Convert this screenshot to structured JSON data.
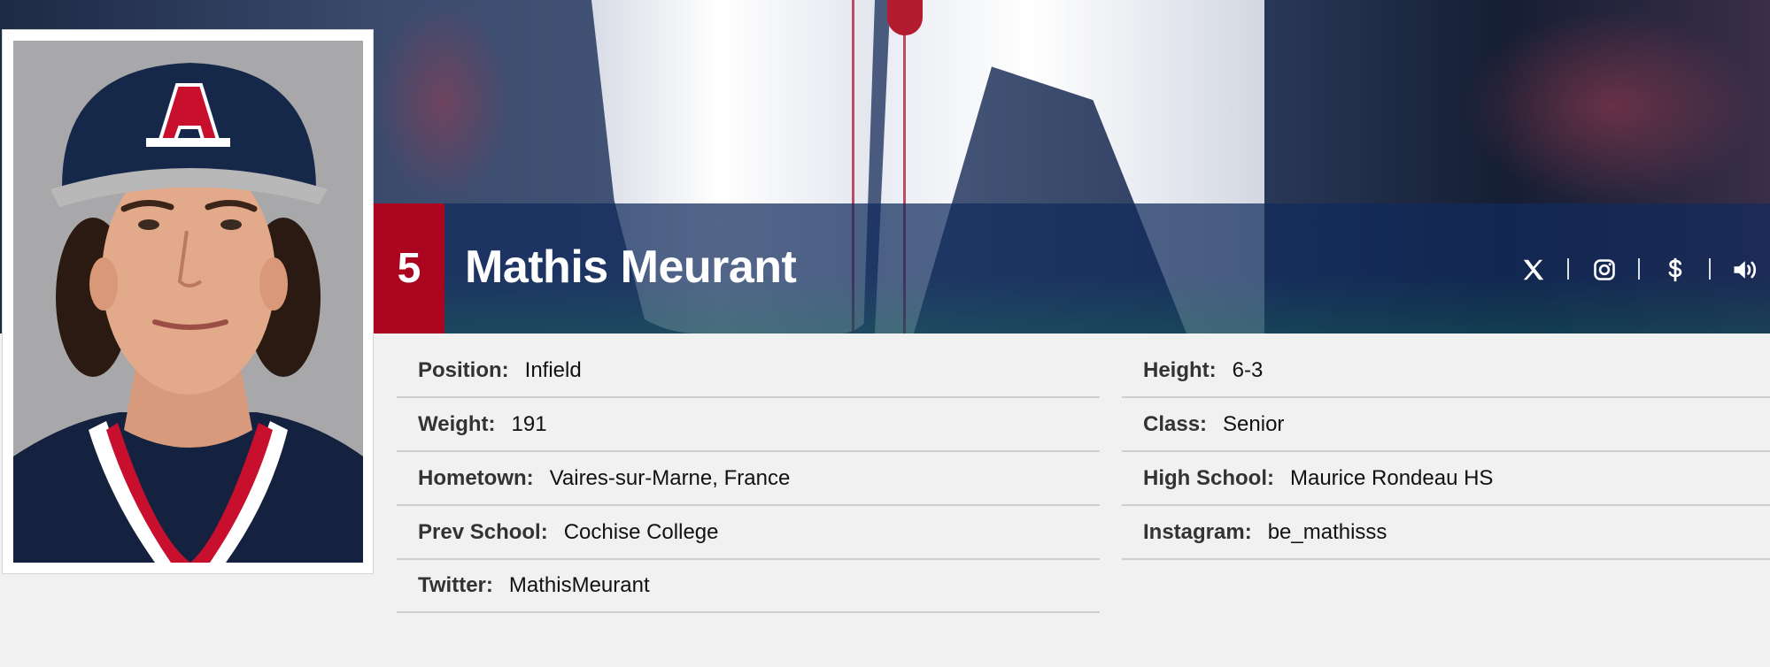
{
  "player": {
    "number": "5",
    "name": "Mathis Meurant"
  },
  "social_icons": [
    "x-twitter-icon",
    "instagram-icon",
    "dollar-icon",
    "speaker-icon"
  ],
  "colors": {
    "accent_red": "#ab0520",
    "navy": "#0c234b",
    "background": "#f1f1f1"
  },
  "bio": {
    "left": [
      {
        "label": "Position:",
        "value": "Infield"
      },
      {
        "label": "Weight:",
        "value": "191"
      },
      {
        "label": "Hometown:",
        "value": "Vaires-sur-Marne, France"
      },
      {
        "label": "Prev School:",
        "value": "Cochise College"
      },
      {
        "label": "Twitter:",
        "value": "MathisMeurant"
      }
    ],
    "right": [
      {
        "label": "Height:",
        "value": "6-3"
      },
      {
        "label": "Class:",
        "value": "Senior"
      },
      {
        "label": "High School:",
        "value": "Maurice Rondeau HS"
      },
      {
        "label": "Instagram:",
        "value": "be_mathisss"
      }
    ]
  }
}
